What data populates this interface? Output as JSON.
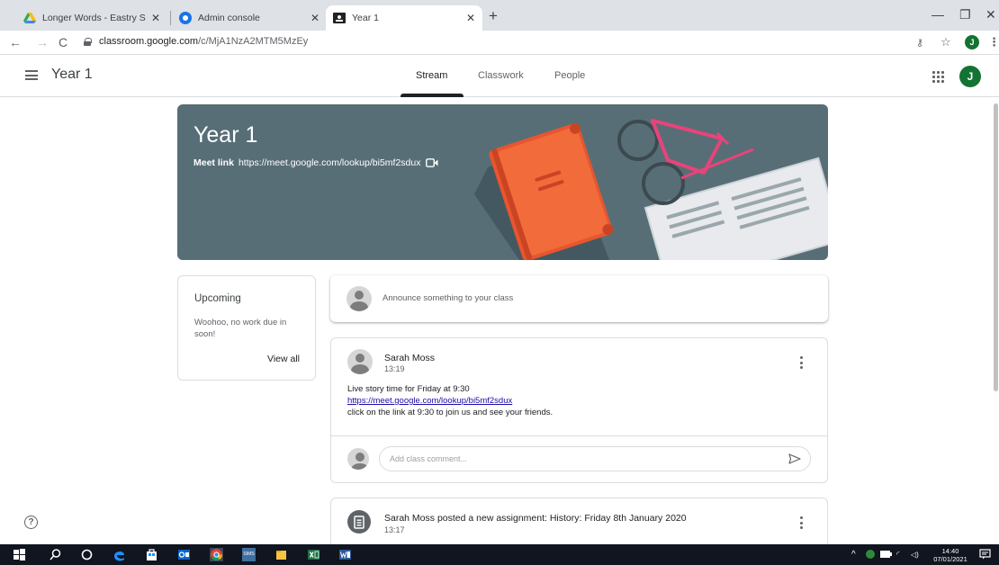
{
  "browser": {
    "tabs": [
      {
        "title": "Longer Words - Eastry Staff shar",
        "icon": "google-drive-icon",
        "active": false
      },
      {
        "title": "Admin console",
        "icon": "admin-console-icon",
        "active": false
      },
      {
        "title": "Year 1",
        "icon": "classroom-icon",
        "active": true
      }
    ],
    "new_tab": "+",
    "url_host": "classroom.google.com",
    "url_path": "/c/MjA1NzA2MTM5MzEy",
    "profile_initial": "J"
  },
  "app": {
    "class_title": "Year 1",
    "nav_tabs": [
      "Stream",
      "Classwork",
      "People"
    ],
    "active_tab": "Stream",
    "user_initial": "J",
    "accent_color": "#137333"
  },
  "banner": {
    "title": "Year 1",
    "meet_label": "Meet link",
    "meet_url": "https://meet.google.com/lookup/bi5mf2sdux",
    "background": "#586e77"
  },
  "upcoming": {
    "title": "Upcoming",
    "text": "Woohoo, no work due in soon!",
    "view_all": "View all"
  },
  "announce": {
    "placeholder": "Announce something to your class"
  },
  "post": {
    "author": "Sarah Moss",
    "time": "13:19",
    "line1": "Live story time for Friday at 9:30",
    "link": "https://meet.google.com/lookup/bi5mf2sdux",
    "line3": "click on the link at 9:30 to join us and see your friends.",
    "comment_placeholder": "Add class comment..."
  },
  "assignment": {
    "title": "Sarah Moss posted a new assignment: History: Friday 8th January 2020",
    "time": "13:17"
  },
  "taskbar": {
    "time": "14:40",
    "date": "07/01/2021",
    "sims_label": "SIMS"
  }
}
